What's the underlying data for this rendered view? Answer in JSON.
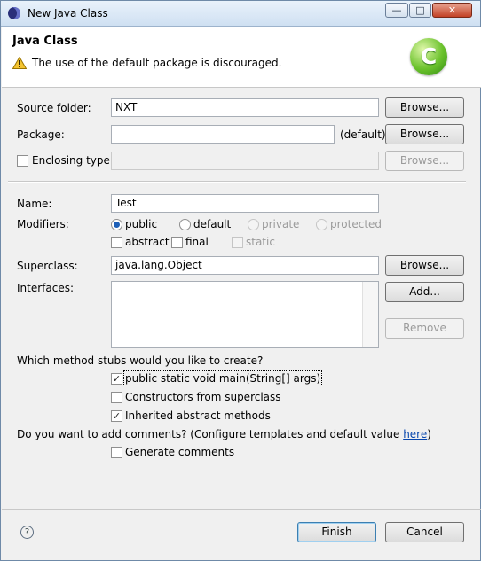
{
  "window": {
    "title": "New Java Class",
    "buttons": {
      "minimize": "—",
      "maximize": "□",
      "close": "✕"
    }
  },
  "header": {
    "title": "Java Class",
    "message": "The use of the default package is discouraged."
  },
  "source_folder": {
    "label": "Source folder:",
    "value": "NXT",
    "browse": "Browse..."
  },
  "package": {
    "label": "Package:",
    "value": "",
    "suffix": "(default)",
    "browse": "Browse..."
  },
  "enclosing_type": {
    "label": "Enclosing type:",
    "checked": false,
    "value": "",
    "browse": "Browse..."
  },
  "name": {
    "label": "Name:",
    "value": "Test"
  },
  "modifiers": {
    "label": "Modifiers:",
    "access": [
      {
        "label": "public",
        "checked": true,
        "enabled": true
      },
      {
        "label": "default",
        "checked": false,
        "enabled": true
      },
      {
        "label": "private",
        "checked": false,
        "enabled": false
      },
      {
        "label": "protected",
        "checked": false,
        "enabled": false
      }
    ],
    "other": [
      {
        "label": "abstract",
        "checked": false,
        "enabled": true
      },
      {
        "label": "final",
        "checked": false,
        "enabled": true
      },
      {
        "label": "static",
        "checked": false,
        "enabled": false
      }
    ]
  },
  "superclass": {
    "label": "Superclass:",
    "value": "java.lang.Object",
    "browse": "Browse..."
  },
  "interfaces": {
    "label": "Interfaces:",
    "add": "Add...",
    "remove": "Remove"
  },
  "stubs": {
    "question": "Which method stubs would you like to create?",
    "options": [
      {
        "label": "public static void main(String[] args)",
        "checked": true
      },
      {
        "label": "Constructors from superclass",
        "checked": false
      },
      {
        "label": "Inherited abstract methods",
        "checked": true
      }
    ]
  },
  "comments": {
    "question_prefix": "Do you want to add comments? (Configure templates and default value ",
    "link": "here",
    "question_suffix": ")",
    "option": {
      "label": "Generate comments",
      "checked": false
    }
  },
  "footer": {
    "finish": "Finish",
    "cancel": "Cancel",
    "help_symbol": "?"
  },
  "icons": {
    "checkmark": "✓"
  },
  "colors": {
    "link": "#0645ad",
    "accent": "#1d5fb7",
    "logo_green": "#6bc22c"
  }
}
